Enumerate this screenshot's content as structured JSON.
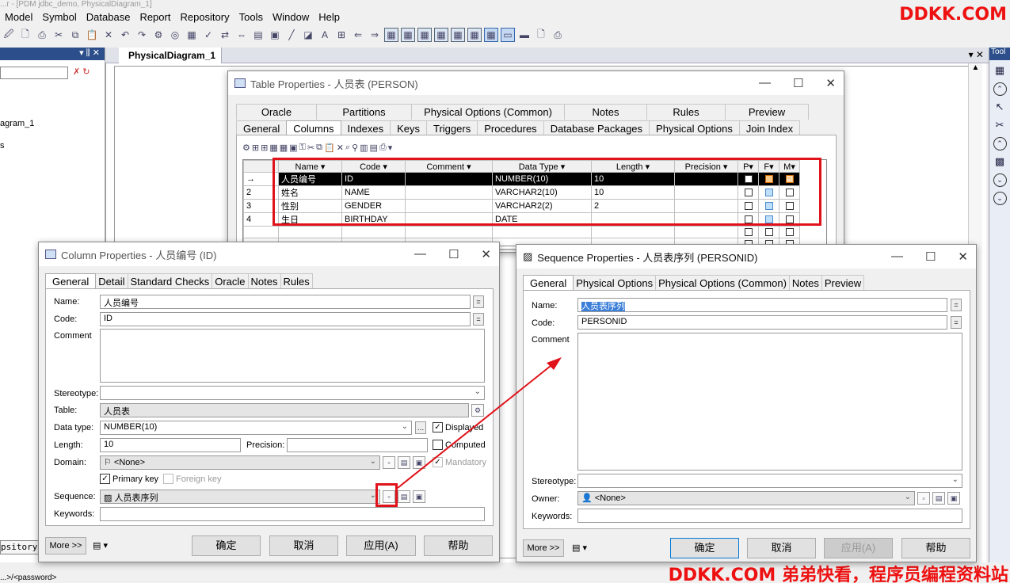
{
  "app": {
    "window_title": "...r - [PDM jdbc_demo, PhysicalDiagram_1]",
    "menu": [
      "Model",
      "Symbol",
      "Database",
      "Report",
      "Repository",
      "Tools",
      "Window",
      "Help"
    ],
    "watermark_top": "DDKK.COM",
    "watermark_bottom": "DDKK.COM 弟弟快看，程序员编程资料站",
    "doc_tab": "PhysicalDiagram_1",
    "tabbar_controls": "▾ ✕",
    "toolbox_title": "Tool",
    "left_panel": {
      "header_controls": "▾ ⫼ ✕",
      "items": [
        "agram_1",
        "s"
      ],
      "repository_tab": "psitory"
    },
    "status_text": "...>/<password>"
  },
  "table_props": {
    "title": "Table Properties - 人员表 (PERSON)",
    "tabs_top": [
      "Oracle",
      "Partitions",
      "Physical Options (Common)",
      "Notes",
      "Rules",
      "Preview"
    ],
    "tabs_bottom": [
      "General",
      "Columns",
      "Indexes",
      "Keys",
      "Triggers",
      "Procedures",
      "Database Packages",
      "Physical Options",
      "Join Index"
    ],
    "active_tab": "Columns",
    "columns_header": [
      "Name",
      "Code",
      "Comment",
      "Data Type",
      "Length",
      "Precision",
      "P",
      "F",
      "M"
    ],
    "rows": [
      {
        "num": "→",
        "name": "人员编号",
        "code": "ID",
        "comment": "",
        "type": "NUMBER(10)",
        "length": "10",
        "precision": "",
        "p": "☑",
        "f": "",
        "m": "☑"
      },
      {
        "num": "2",
        "name": "姓名",
        "code": "NAME",
        "comment": "",
        "type": "VARCHAR2(10)",
        "length": "10",
        "precision": "",
        "p": "",
        "f": "",
        "m": ""
      },
      {
        "num": "3",
        "name": "性别",
        "code": "GENDER",
        "comment": "",
        "type": "VARCHAR2(2)",
        "length": "2",
        "precision": "",
        "p": "",
        "f": "",
        "m": ""
      },
      {
        "num": "4",
        "name": "生日",
        "code": "BIRTHDAY",
        "comment": "",
        "type": "DATE",
        "length": "",
        "precision": "",
        "p": "",
        "f": "",
        "m": ""
      }
    ]
  },
  "column_props": {
    "title": "Column Properties - 人员编号 (ID)",
    "tabs": [
      "General",
      "Detail",
      "Standard Checks",
      "Oracle",
      "Notes",
      "Rules"
    ],
    "labels": {
      "name": "Name:",
      "code": "Code:",
      "comment": "Comment",
      "stereotype": "Stereotype:",
      "table": "Table:",
      "datatype": "Data type:",
      "length": "Length:",
      "precision": "Precision:",
      "domain": "Domain:",
      "sequence": "Sequence:",
      "keywords": "Keywords:"
    },
    "values": {
      "name": "人员编号",
      "code": "ID",
      "table": "人员表",
      "datatype": "NUMBER(10)",
      "length": "10",
      "domain": "<None>",
      "sequence": "人员表序列"
    },
    "checks": {
      "displayed": "Displayed",
      "computed": "Computed",
      "mandatory": "Mandatory",
      "primary_key": "Primary key",
      "foreign_key": "Foreign key"
    },
    "buttons": {
      "more": "More >>",
      "ok": "确定",
      "cancel": "取消",
      "apply": "应用(A)",
      "help": "帮助"
    }
  },
  "sequence_props": {
    "title": "Sequence Properties - 人员表序列 (PERSONID)",
    "tabs": [
      "General",
      "Physical Options",
      "Physical Options (Common)",
      "Notes",
      "Preview"
    ],
    "labels": {
      "name": "Name:",
      "code": "Code:",
      "comment": "Comment",
      "stereotype": "Stereotype:",
      "owner": "Owner:",
      "keywords": "Keywords:"
    },
    "values": {
      "name": "人员表序列",
      "code": "PERSONID",
      "owner": "<None>"
    },
    "buttons": {
      "more": "More >>",
      "ok": "确定",
      "cancel": "取消",
      "apply": "应用(A)",
      "help": "帮助"
    }
  },
  "colors": {
    "highlight": "#e0131a",
    "accent": "#0078d7",
    "watermark": "#ee1111"
  }
}
